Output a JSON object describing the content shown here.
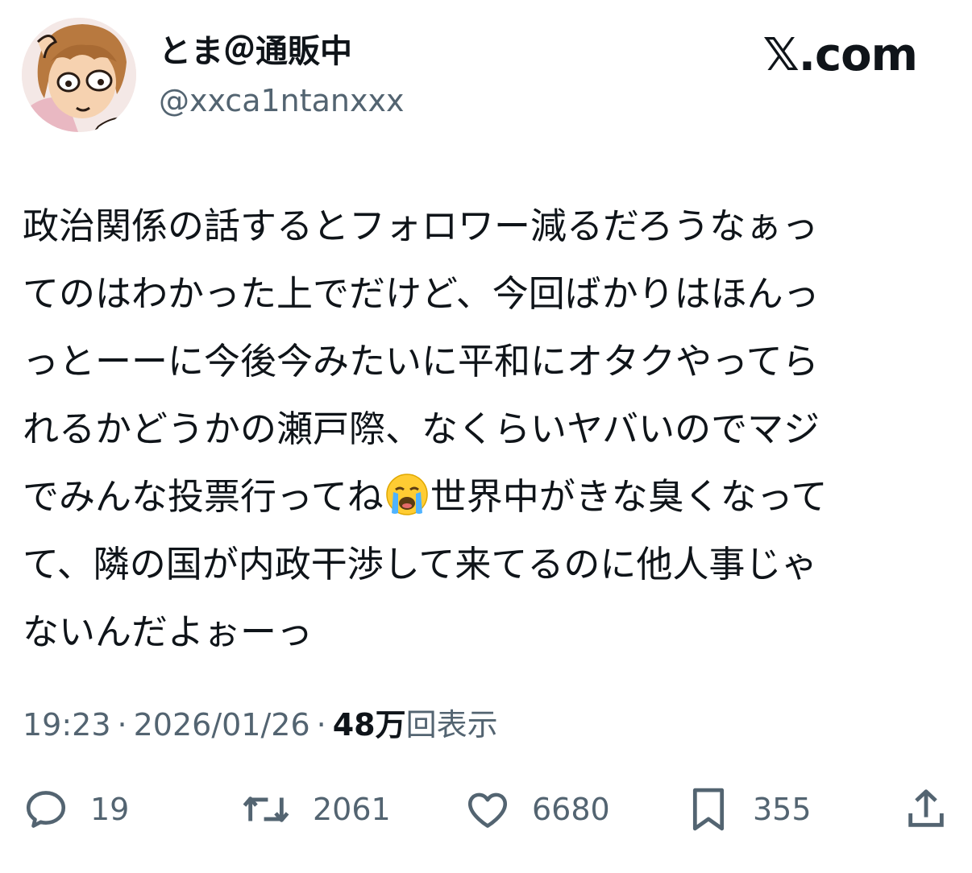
{
  "author": {
    "display_name": "とま＠通販中",
    "handle": "@xxca1ntanxxx"
  },
  "brand": "𝕏.com",
  "tweet": {
    "lines": [
      "政治関係の話するとフォロワー減るだろうなぁっ",
      "てのはわかった上でだけど、今回ばかりはほんっ",
      "っとーーに今後今みたいに平和にオタクやってら",
      "れるかどうかの瀬戸際、なくらいヤバいのでマジ",
      "でみんな投票行ってね",
      "世界中がきな臭くなって",
      "て、隣の国が内政干渉して来てるのに他人事じゃ",
      "ないんだよぉーっ"
    ]
  },
  "meta": {
    "time": "19:23",
    "separator": "·",
    "date": "2026/01/26",
    "views_count": "48万",
    "views_label": "回表示"
  },
  "actions": {
    "reply_count": "19",
    "repost_count": "2061",
    "like_count": "6680",
    "bookmark_count": "355"
  },
  "colors": {
    "text": "#0f1419",
    "secondary": "#536471",
    "background": "#ffffff"
  },
  "icons": [
    "reply-icon",
    "repost-icon",
    "like-icon",
    "bookmark-icon",
    "share-icon",
    "crying-face-emoji"
  ]
}
